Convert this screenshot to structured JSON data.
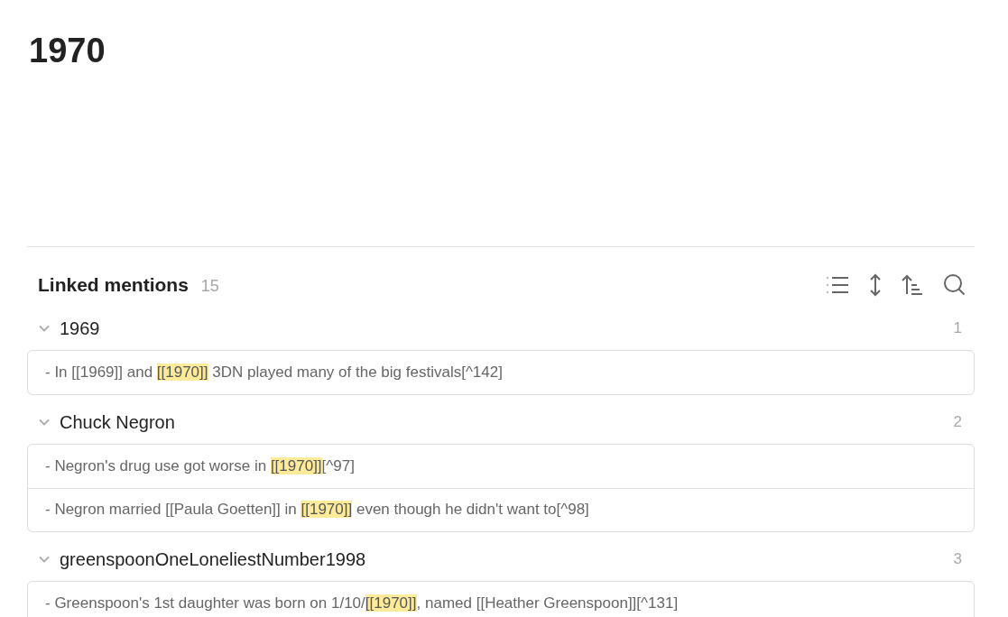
{
  "page_title": "1970",
  "linked_mentions": {
    "title": "Linked mentions",
    "count": "15",
    "groups": [
      {
        "title": "1969",
        "count": "1",
        "expanded": true,
        "mentions": [
          {
            "parts": [
              {
                "text": "- In [[1969]] and ",
                "highlighted": false
              },
              {
                "text": "[[1970]]",
                "highlighted": true
              },
              {
                "text": " 3DN played many of the big festivals[^142]",
                "highlighted": false
              }
            ]
          }
        ]
      },
      {
        "title": "Chuck Negron",
        "count": "2",
        "expanded": true,
        "mentions": [
          {
            "parts": [
              {
                "text": "- Negron's drug use got worse in ",
                "highlighted": false
              },
              {
                "text": "[[1970]]",
                "highlighted": true
              },
              {
                "text": "[^97]",
                "highlighted": false
              }
            ]
          },
          {
            "parts": [
              {
                "text": "- Negron married [[Paula Goetten]] in ",
                "highlighted": false
              },
              {
                "text": "[[1970]]",
                "highlighted": true
              },
              {
                "text": " even though he didn't want to[^98]",
                "highlighted": false
              }
            ]
          }
        ]
      },
      {
        "title": "greenspoonOneLoneliestNumber1998",
        "count": "3",
        "expanded": true,
        "mentions": [
          {
            "parts": [
              {
                "text": "- Greenspoon's 1st daughter was born on 1/10/",
                "highlighted": false
              },
              {
                "text": "[[1970]]",
                "highlighted": true
              },
              {
                "text": ", named [[Heather Greenspoon]][^131]",
                "highlighted": false
              }
            ]
          }
        ]
      }
    ]
  }
}
